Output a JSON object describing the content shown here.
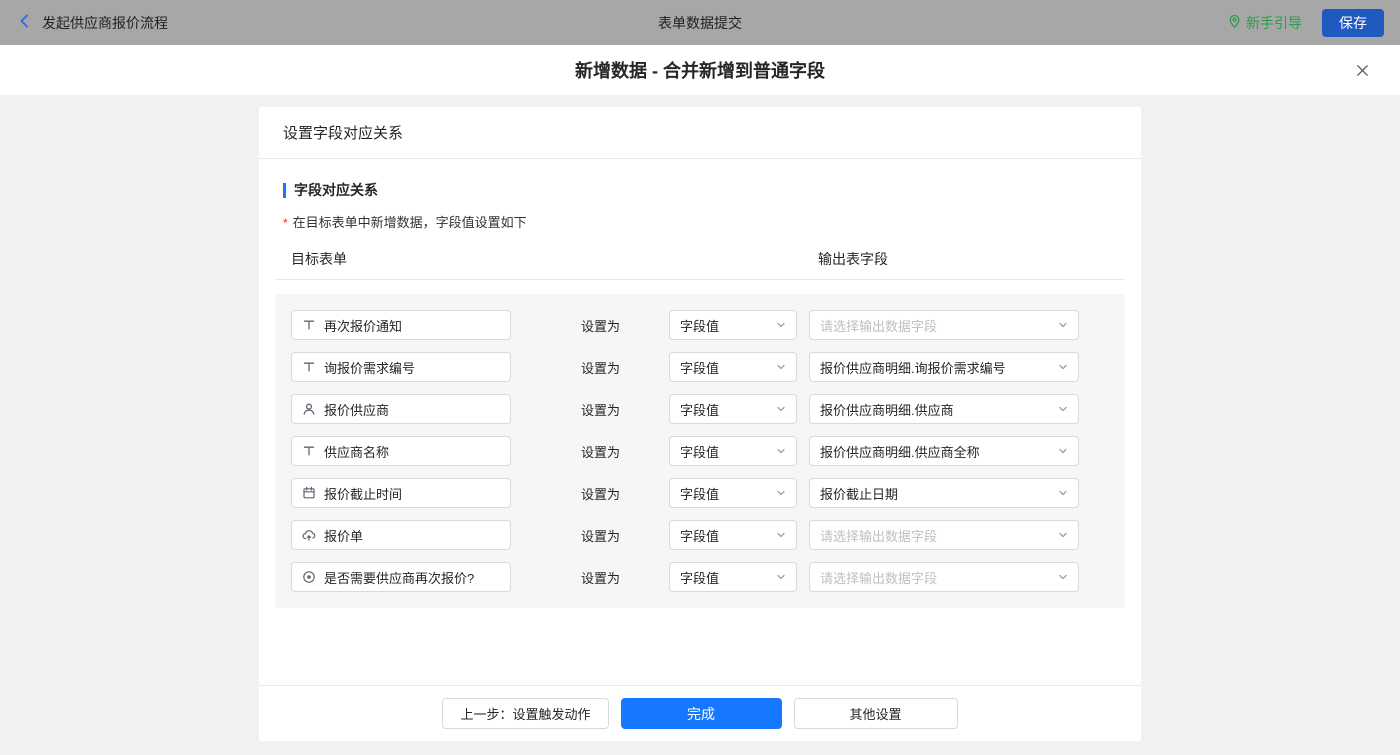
{
  "topbar": {
    "back_label": "发起供应商报价流程",
    "title": "表单数据提交",
    "guide_label": "新手引导",
    "save_label": "保存"
  },
  "modal": {
    "title": "新增数据 - 合并新增到普通字段"
  },
  "card": {
    "title": "设置字段对应关系",
    "section_title": "字段对应关系",
    "required_mark": "*",
    "hint": "在目标表单中新增数据，字段值设置如下",
    "columns": {
      "target": "目标表单",
      "output": "输出表字段"
    },
    "set_as_label": "设置为",
    "rows": [
      {
        "icon": "text-field-icon",
        "field": "再次报价通知",
        "value_type": "字段值",
        "output": "请选择输出数据字段",
        "is_placeholder": true
      },
      {
        "icon": "text-field-icon",
        "field": "询报价需求编号",
        "value_type": "字段值",
        "output": "报价供应商明细.询报价需求编号",
        "is_placeholder": false
      },
      {
        "icon": "user-icon",
        "field": "报价供应商",
        "value_type": "字段值",
        "output": "报价供应商明细.供应商",
        "is_placeholder": false
      },
      {
        "icon": "text-field-icon",
        "field": "供应商名称",
        "value_type": "字段值",
        "output": "报价供应商明细.供应商全称",
        "is_placeholder": false
      },
      {
        "icon": "calendar-icon",
        "field": "报价截止时间",
        "value_type": "字段值",
        "output": "报价截止日期",
        "is_placeholder": false
      },
      {
        "icon": "cloud-upload-icon",
        "field": "报价单",
        "value_type": "字段值",
        "output": "请选择输出数据字段",
        "is_placeholder": true
      },
      {
        "icon": "radio-icon",
        "field": "是否需要供应商再次报价?",
        "value_type": "字段值",
        "output": "请选择输出数据字段",
        "is_placeholder": true
      }
    ],
    "footer": {
      "prev_label": "上一步：设置触发动作",
      "done_label": "完成",
      "other_label": "其他设置"
    }
  },
  "colors": {
    "primary_blue": "#1677ff",
    "guide_green": "#2b9e4c",
    "required_red": "#f5222d",
    "save_button_blue": "#2059c0",
    "topbar_gray": "#a7a7a7"
  }
}
